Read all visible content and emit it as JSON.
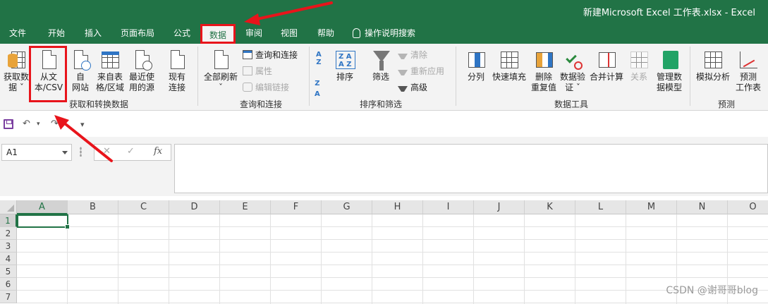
{
  "window": {
    "title": "新建Microsoft Excel 工作表.xlsx  -  Excel"
  },
  "tabs": [
    {
      "label": "文件"
    },
    {
      "label": "开始"
    },
    {
      "label": "插入"
    },
    {
      "label": "页面布局"
    },
    {
      "label": "公式"
    },
    {
      "label": "数据"
    },
    {
      "label": "审阅"
    },
    {
      "label": "视图"
    },
    {
      "label": "帮助"
    },
    {
      "label": "操作说明搜索"
    }
  ],
  "ribbon": {
    "get_data": {
      "group_label": "获取和转换数据",
      "get_data_line1": "获取数",
      "get_data_line2": "据 ˇ",
      "from_text_line1": "从文",
      "from_text_line2": "本/CSV",
      "from_web_line1": "自",
      "from_web_line2": "网站",
      "from_table_line1": "来自表",
      "from_table_line2": "格/区域",
      "recent_line1": "最近使",
      "recent_line2": "用的源",
      "existing_line1": "现有",
      "existing_line2": "连接"
    },
    "queries": {
      "group_label": "查询和连接",
      "refresh_line1": "全部刷新",
      "refresh_line2": "ˇ",
      "queries_connections": "查询和连接",
      "properties": "属性",
      "edit_links": "编辑链接"
    },
    "sort_filter": {
      "group_label": "排序和筛选",
      "sort": "排序",
      "filter": "筛选",
      "clear": "清除",
      "reapply": "重新应用",
      "advanced": "高级"
    },
    "data_tools": {
      "group_label": "数据工具",
      "text_to_columns": "分列",
      "flash_fill": "快速填充",
      "remove_dup_line1": "删除",
      "remove_dup_line2": "重复值",
      "validation_line1": "数据验",
      "validation_line2": "证 ˇ",
      "consolidate": "合并计算",
      "relationships": "关系",
      "data_model_line1": "管理数",
      "data_model_line2": "据模型"
    },
    "forecast": {
      "group_label": "预测",
      "what_if": "模拟分析",
      "forecast_line1": "预测",
      "forecast_line2": "工作表"
    }
  },
  "formula_bar": {
    "name_box": "A1",
    "cancel": "✕",
    "enter": "✓",
    "fx": "fx",
    "value": ""
  },
  "sheet": {
    "columns": [
      "A",
      "B",
      "C",
      "D",
      "E",
      "F",
      "G",
      "H",
      "I",
      "J",
      "K",
      "L",
      "M",
      "N",
      "O"
    ],
    "rows": [
      "1",
      "2",
      "3",
      "4",
      "5",
      "6",
      "7"
    ],
    "active_cell": "A1"
  },
  "watermark": "CSDN @谢哥哥blog",
  "colors": {
    "excel_green": "#217346",
    "annotation_red": "#e8141b"
  }
}
